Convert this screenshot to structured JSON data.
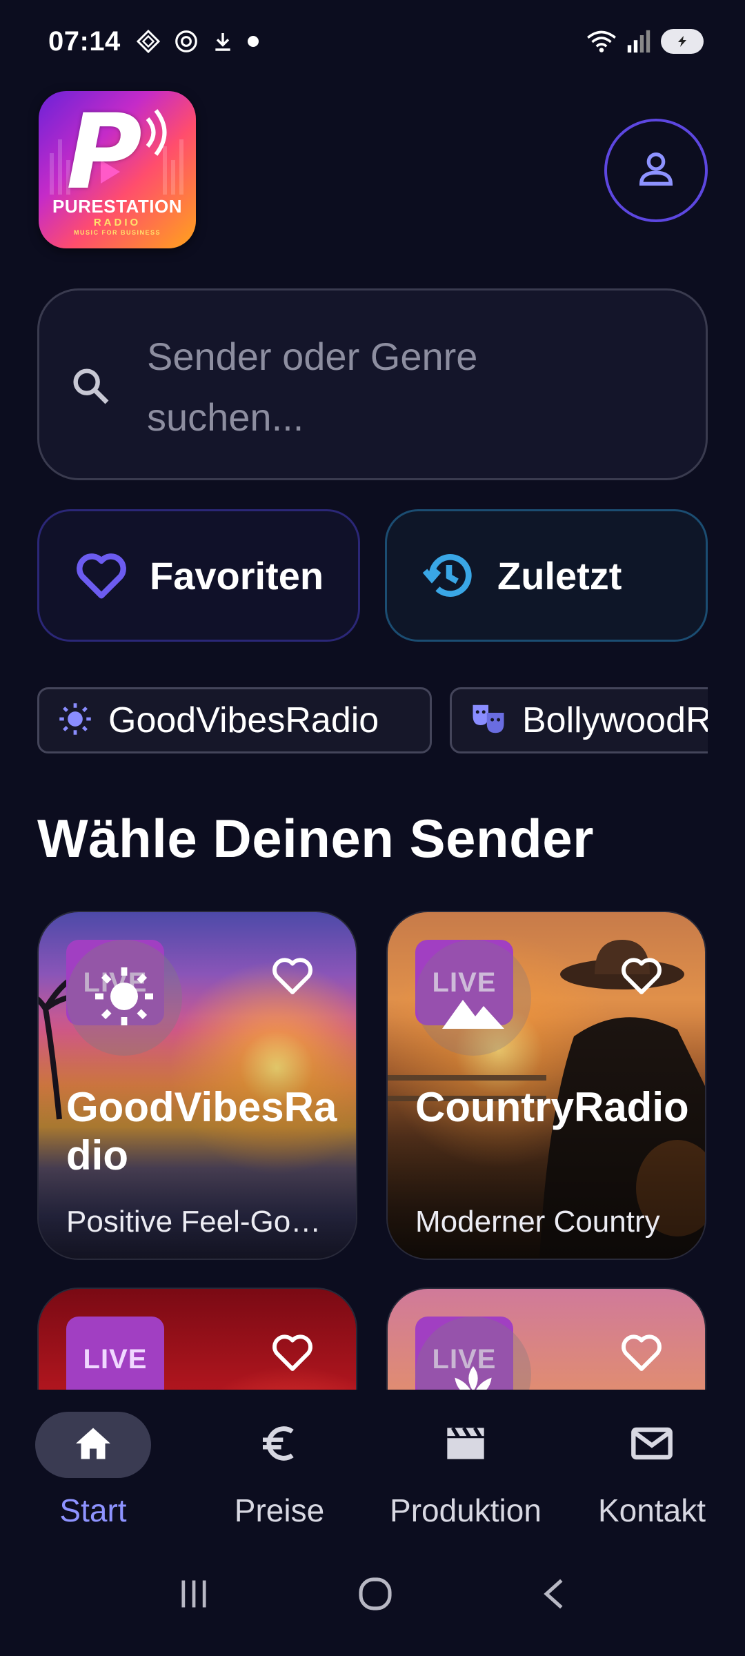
{
  "status_bar": {
    "time": "07:14",
    "left_icons": [
      "notification-icon",
      "openai-icon",
      "download-icon",
      "dot-icon"
    ],
    "right_icons": [
      "wifi-icon",
      "signal-icon",
      "battery-icon"
    ]
  },
  "header": {
    "logo": {
      "name": "PURESTATION",
      "sub": "RADIO",
      "tagline": "MUSIC FOR BUSINESS"
    },
    "profile_icon": "person-icon"
  },
  "search": {
    "placeholder": "Sender oder Genre suchen..."
  },
  "quick_buttons": {
    "favorites": "Favoriten",
    "recent": "Zuletzt"
  },
  "chips": [
    {
      "label": "GoodVibesRadio",
      "icon": "sun-icon"
    },
    {
      "label": "BollywoodRadio",
      "icon": "theater-masks-icon"
    }
  ],
  "section_title": "Wähle Deinen Sender",
  "stations": [
    {
      "name": "GoodVibesRadio",
      "description": "Positive Feel-Good Music",
      "badge": "LIVE",
      "genre_icon": "sun-icon"
    },
    {
      "name": "CountryRadio",
      "description": "Moderner Country",
      "badge": "LIVE",
      "genre_icon": "mountain-icon"
    },
    {
      "name": "",
      "description": "",
      "badge": "LIVE",
      "genre_icon": ""
    },
    {
      "name": "",
      "description": "",
      "badge": "LIVE",
      "genre_icon": "lotus-icon"
    }
  ],
  "bottom_nav": [
    {
      "label": "Start",
      "icon": "home-icon",
      "active": true
    },
    {
      "label": "Preise",
      "icon": "euro-icon",
      "active": false
    },
    {
      "label": "Produktion",
      "icon": "clapperboard-icon",
      "active": false
    },
    {
      "label": "Kontakt",
      "icon": "mail-icon",
      "active": false
    }
  ],
  "colors": {
    "background": "#0c0d1f",
    "accent": "#8e93ff",
    "badge": "#a13fc2"
  }
}
